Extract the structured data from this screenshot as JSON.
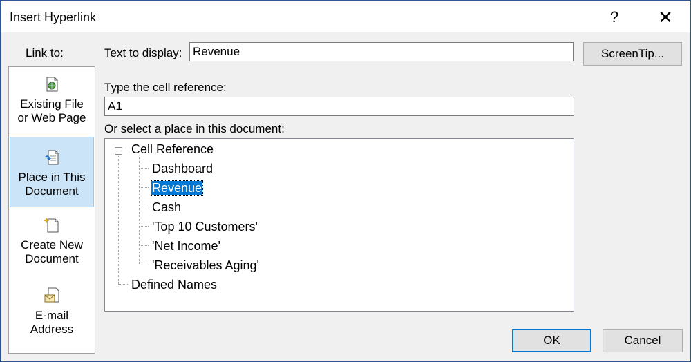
{
  "window": {
    "title": "Insert Hyperlink",
    "help_glyph": "?",
    "close_glyph": "✕"
  },
  "sidebar": {
    "heading": "Link to:",
    "items": [
      {
        "line1": "Existing File",
        "line2": "or Web Page",
        "icon": "existing-file-icon",
        "selected": false
      },
      {
        "line1": "Place in This",
        "line2": "Document",
        "icon": "place-in-document-icon",
        "selected": true
      },
      {
        "line1": "Create New",
        "line2": "Document",
        "icon": "create-new-document-icon",
        "selected": false
      },
      {
        "line1": "E-mail",
        "line2": "Address",
        "icon": "email-address-icon",
        "selected": false
      }
    ]
  },
  "form": {
    "text_to_display_label": "Text to display:",
    "text_to_display_value": "Revenue",
    "screentip_label": "ScreenTip...",
    "cell_ref_label": "Type the cell reference:",
    "cell_ref_value": "A1",
    "place_label": "Or select a place in this document:"
  },
  "tree": {
    "root": "Cell Reference",
    "children": [
      "Dashboard",
      "Revenue",
      "Cash",
      "'Top 10 Customers'",
      "'Net Income'",
      "'Receivables Aging'"
    ],
    "selected_index": 1,
    "second_root": "Defined Names"
  },
  "buttons": {
    "ok": "OK",
    "cancel": "Cancel"
  },
  "colors": {
    "selection": "#0078d7",
    "sidebar_selected": "#cce4f7",
    "dialog_bg": "#f0f0f0"
  }
}
